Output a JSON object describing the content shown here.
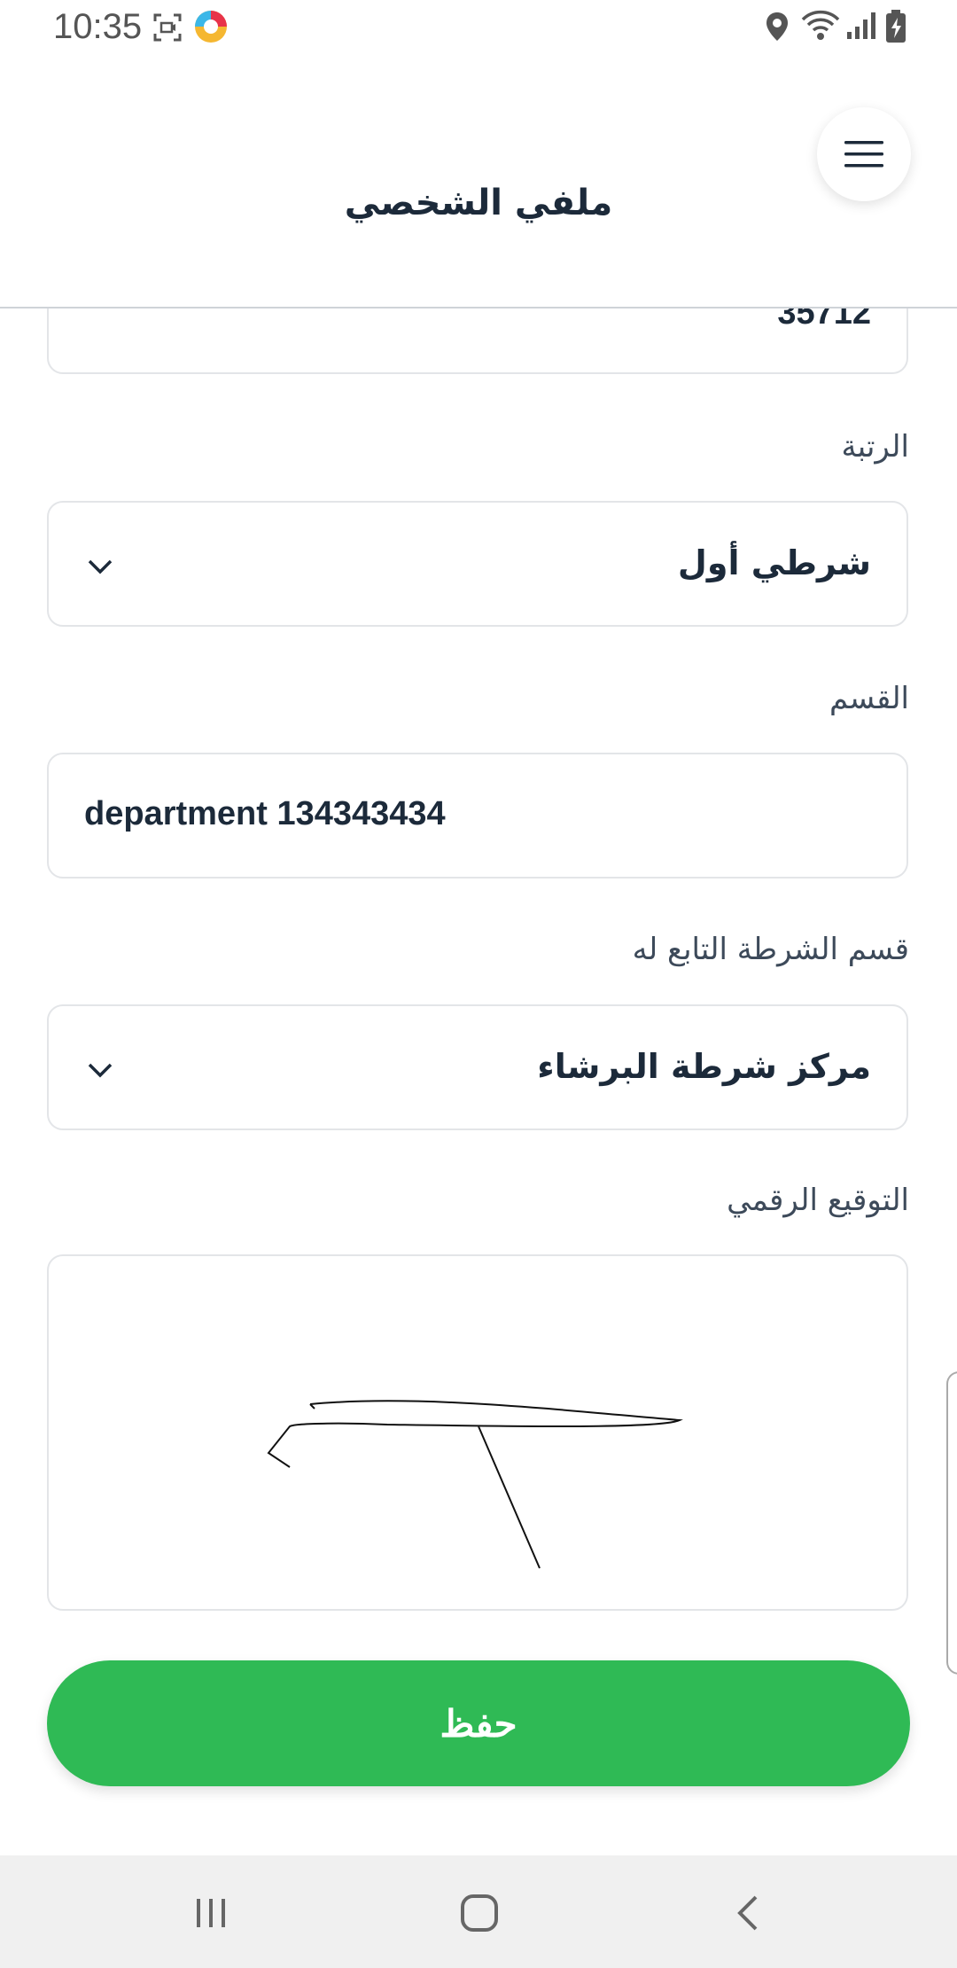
{
  "status_bar": {
    "time": "10:35",
    "icons": [
      "screen-record-icon",
      "app-logo-icon",
      "location-icon",
      "wifi-icon",
      "signal-icon",
      "battery-charging-icon"
    ]
  },
  "header": {
    "title": "ملفي الشخصي",
    "menu_icon": "hamburger-menu-icon"
  },
  "form": {
    "partial_field_value": "35712",
    "rank": {
      "label": "الرتبة",
      "value": "شرطي أول"
    },
    "department": {
      "label": "القسم",
      "value": "department 134343434"
    },
    "police_station": {
      "label": "قسم الشرطة التابع له",
      "value": "مركز شرطة البرشاء"
    },
    "signature": {
      "label": "التوقيع الرقمي"
    },
    "save_label": "حفظ"
  },
  "colors": {
    "primary_green": "#2fba55",
    "text_dark": "#1c2a3a",
    "border": "#e3e5e8"
  },
  "nav_bar": {
    "icons": [
      "recent-apps-icon",
      "home-icon",
      "back-icon"
    ]
  }
}
